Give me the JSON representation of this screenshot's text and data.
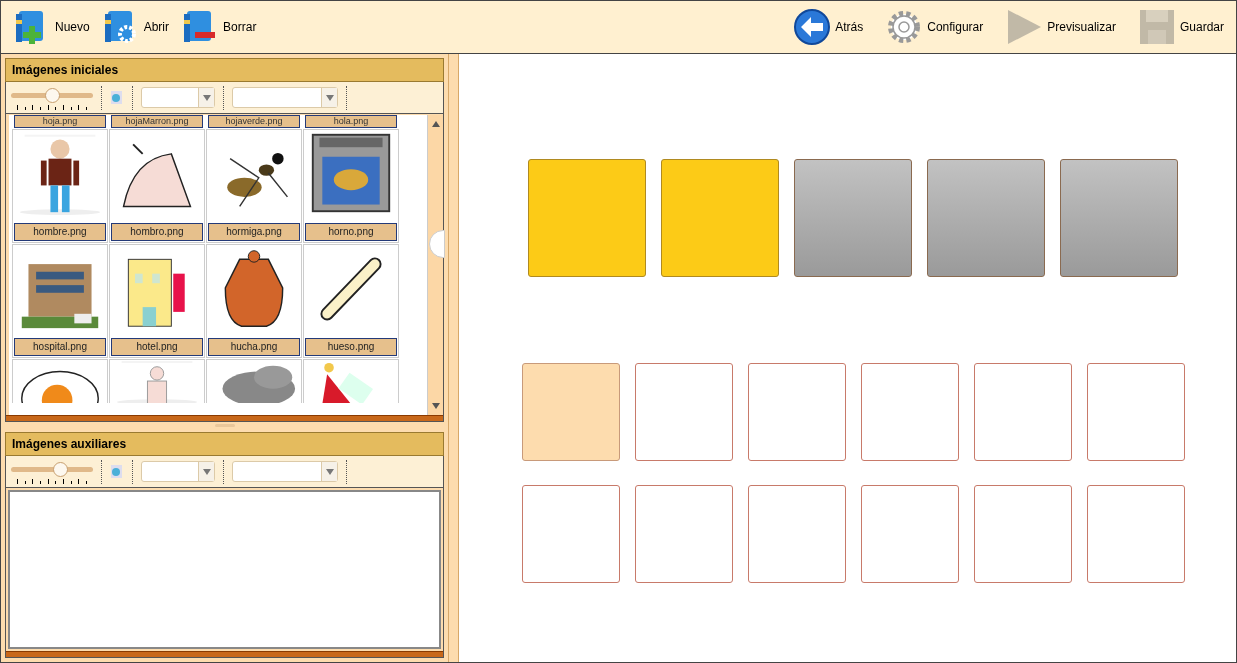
{
  "toolbar": {
    "left": [
      {
        "kind": "new",
        "label": "Nuevo",
        "disabled": false
      },
      {
        "kind": "open",
        "label": "Abrir",
        "disabled": false
      },
      {
        "kind": "delete",
        "label": "Borrar",
        "disabled": false
      }
    ],
    "right": [
      {
        "kind": "back",
        "label": "Atrás",
        "disabled": false
      },
      {
        "kind": "settings",
        "label": "Configurar",
        "disabled": false
      },
      {
        "kind": "preview",
        "label": "Previsualizar",
        "disabled": true
      },
      {
        "kind": "save",
        "label": "Guardar",
        "disabled": true
      }
    ]
  },
  "panels": [
    {
      "title": "Imágenes iniciales",
      "zoom": {
        "level": 0.5
      },
      "partial_labels": [
        "hoja.png",
        "hojaMarron.png",
        "hojaverde.png",
        "hola.png"
      ],
      "images": [
        {
          "label": "hombre.png"
        },
        {
          "label": "hombro.png"
        },
        {
          "label": "hormiga.png"
        },
        {
          "label": "horno.png"
        },
        {
          "label": "hospital.png"
        },
        {
          "label": "hotel.png"
        },
        {
          "label": "hucha.png"
        },
        {
          "label": "hueso.png"
        },
        {
          "kind": "picture"
        },
        {
          "kind": "picture"
        },
        {
          "kind": "picture"
        },
        {
          "kind": "picture"
        }
      ]
    },
    {
      "title": "Imágenes auxiliares",
      "zoom": {
        "level": 0.6
      }
    }
  ],
  "target_slots": [
    {
      "filled": true
    },
    {
      "filled": true
    },
    {
      "filled": false
    },
    {
      "filled": false
    },
    {
      "filled": false
    }
  ],
  "answer_rows": [
    [
      {
        "selected": true
      },
      {
        "selected": false
      },
      {
        "selected": false
      },
      {
        "selected": false
      },
      {
        "selected": false
      },
      {
        "selected": false
      }
    ],
    [
      {
        "selected": false
      },
      {
        "selected": false
      },
      {
        "selected": false
      },
      {
        "selected": false
      },
      {
        "selected": false
      },
      {
        "selected": false
      }
    ]
  ]
}
